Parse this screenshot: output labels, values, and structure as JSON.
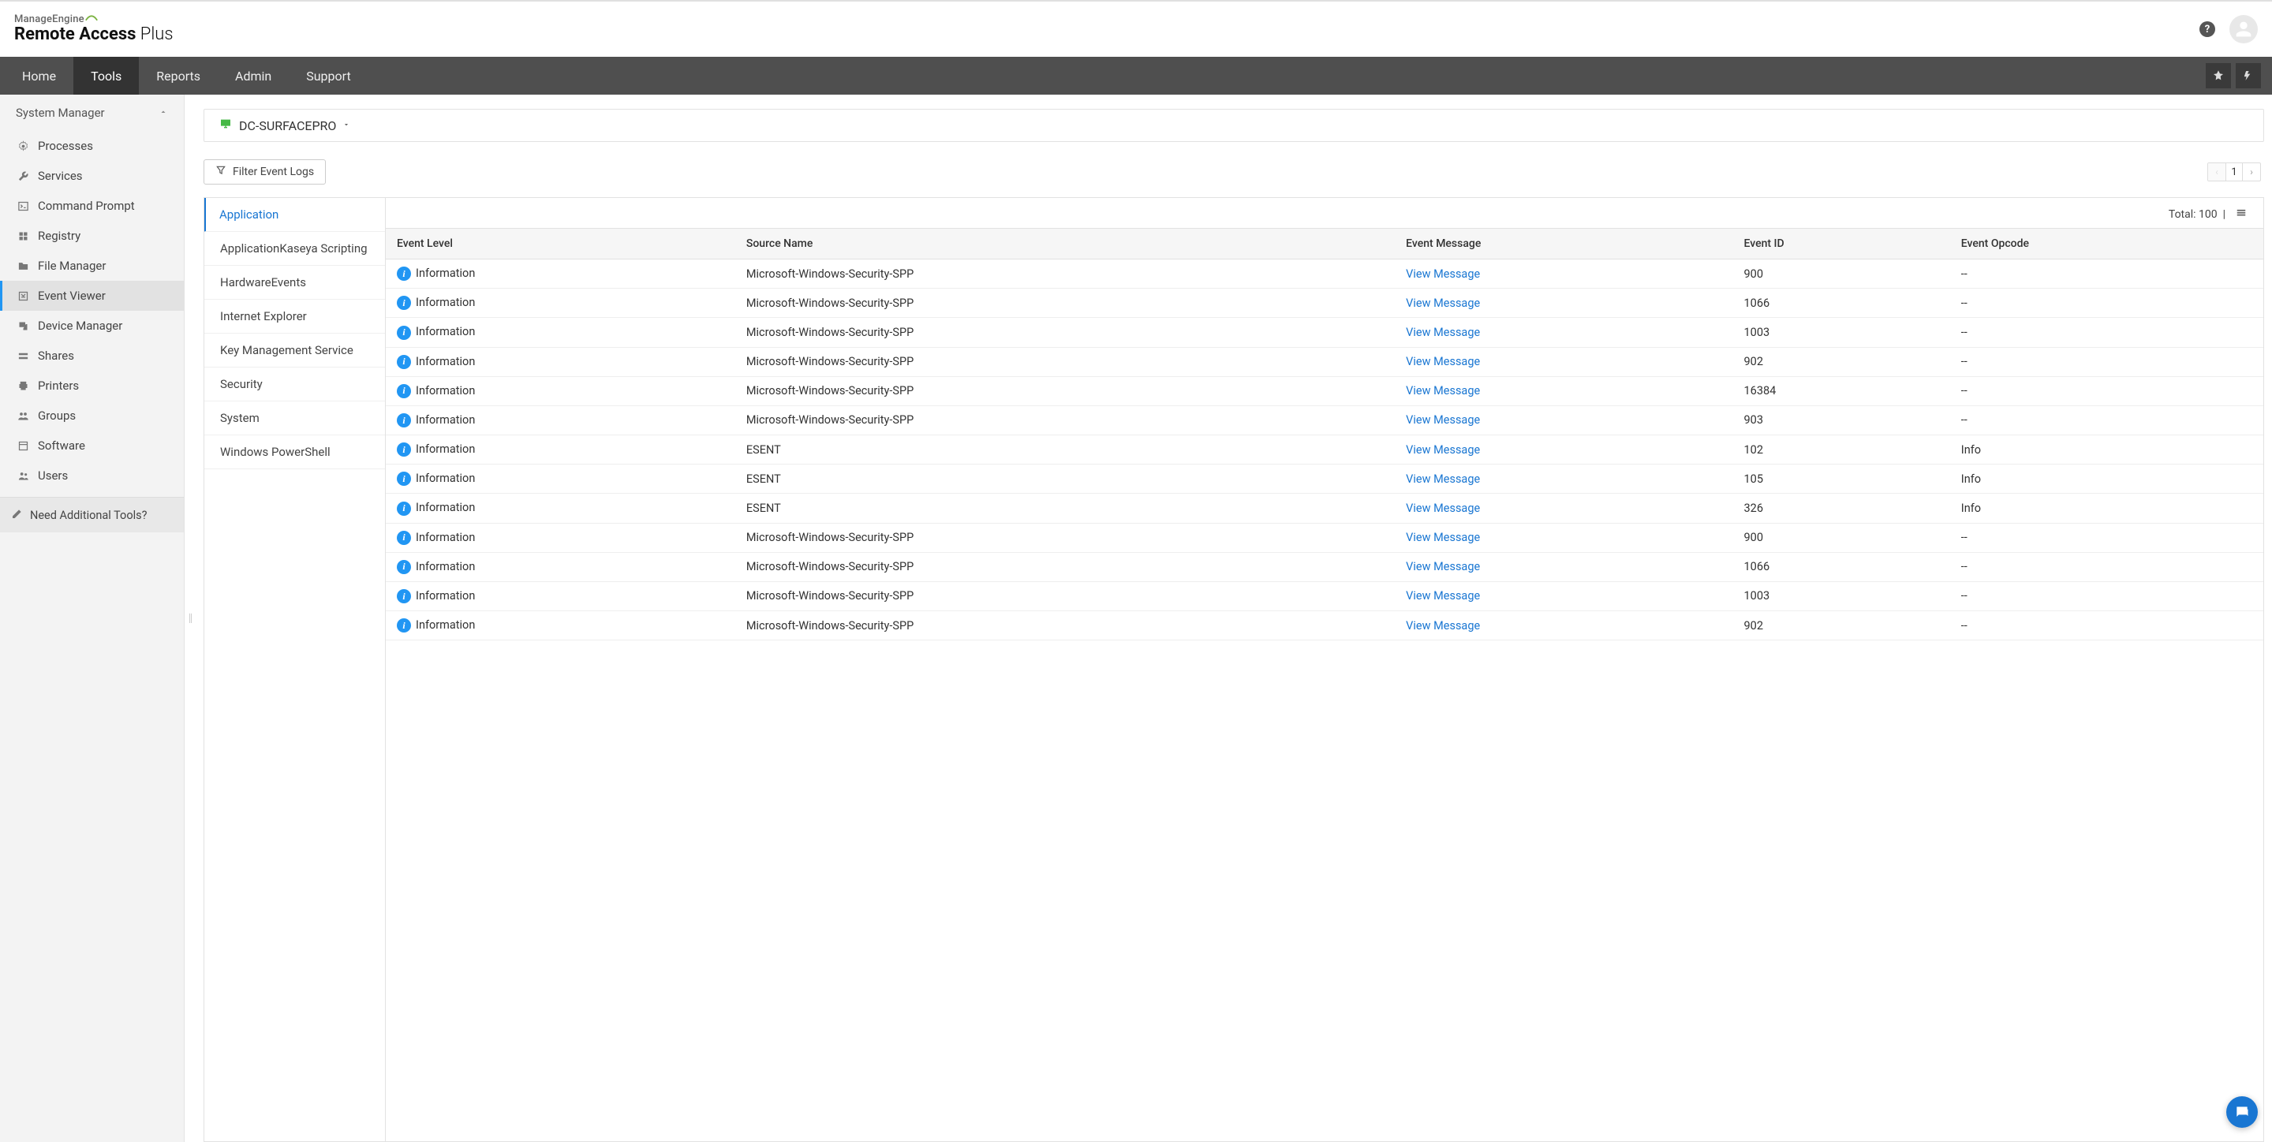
{
  "brand": {
    "me": "ManageEngine",
    "rap_bold": "Remote Access",
    "rap_light": " Plus"
  },
  "nav": {
    "items": [
      "Home",
      "Tools",
      "Reports",
      "Admin",
      "Support"
    ],
    "active_index": 1
  },
  "sidebar": {
    "section": "System Manager",
    "items": [
      {
        "label": "Processes",
        "icon": "gear-icon"
      },
      {
        "label": "Services",
        "icon": "wrench-icon"
      },
      {
        "label": "Command Prompt",
        "icon": "terminal-icon"
      },
      {
        "label": "Registry",
        "icon": "cubes-icon"
      },
      {
        "label": "File Manager",
        "icon": "folder-icon"
      },
      {
        "label": "Event Viewer",
        "icon": "event-icon"
      },
      {
        "label": "Device Manager",
        "icon": "device-icon"
      },
      {
        "label": "Shares",
        "icon": "share-icon"
      },
      {
        "label": "Printers",
        "icon": "printer-icon"
      },
      {
        "label": "Groups",
        "icon": "groups-icon"
      },
      {
        "label": "Software",
        "icon": "software-icon"
      },
      {
        "label": "Users",
        "icon": "users-icon"
      }
    ],
    "active_index": 5,
    "need_more": "Need Additional Tools?"
  },
  "device": {
    "name": "DC-SURFACEPRO"
  },
  "filter_label": "Filter Event Logs",
  "pager": {
    "page": "1"
  },
  "categories": {
    "items": [
      "Application",
      "ApplicationKaseya Scripting",
      "HardwareEvents",
      "Internet Explorer",
      "Key Management Service",
      "Security",
      "System",
      "Windows PowerShell"
    ],
    "active_index": 0
  },
  "total_label": "Total: 100",
  "columns": [
    "Event Level",
    "Source Name",
    "Event Message",
    "Event ID",
    "Event Opcode"
  ],
  "view_message_label": "View Message",
  "level_label": "Information",
  "rows": [
    {
      "source": "Microsoft-Windows-Security-SPP",
      "id": "900",
      "opcode": "--"
    },
    {
      "source": "Microsoft-Windows-Security-SPP",
      "id": "1066",
      "opcode": "--"
    },
    {
      "source": "Microsoft-Windows-Security-SPP",
      "id": "1003",
      "opcode": "--"
    },
    {
      "source": "Microsoft-Windows-Security-SPP",
      "id": "902",
      "opcode": "--"
    },
    {
      "source": "Microsoft-Windows-Security-SPP",
      "id": "16384",
      "opcode": "--"
    },
    {
      "source": "Microsoft-Windows-Security-SPP",
      "id": "903",
      "opcode": "--"
    },
    {
      "source": "ESENT",
      "id": "102",
      "opcode": "Info"
    },
    {
      "source": "ESENT",
      "id": "105",
      "opcode": "Info"
    },
    {
      "source": "ESENT",
      "id": "326",
      "opcode": "Info"
    },
    {
      "source": "Microsoft-Windows-Security-SPP",
      "id": "900",
      "opcode": "--"
    },
    {
      "source": "Microsoft-Windows-Security-SPP",
      "id": "1066",
      "opcode": "--"
    },
    {
      "source": "Microsoft-Windows-Security-SPP",
      "id": "1003",
      "opcode": "--"
    },
    {
      "source": "Microsoft-Windows-Security-SPP",
      "id": "902",
      "opcode": "--"
    }
  ]
}
